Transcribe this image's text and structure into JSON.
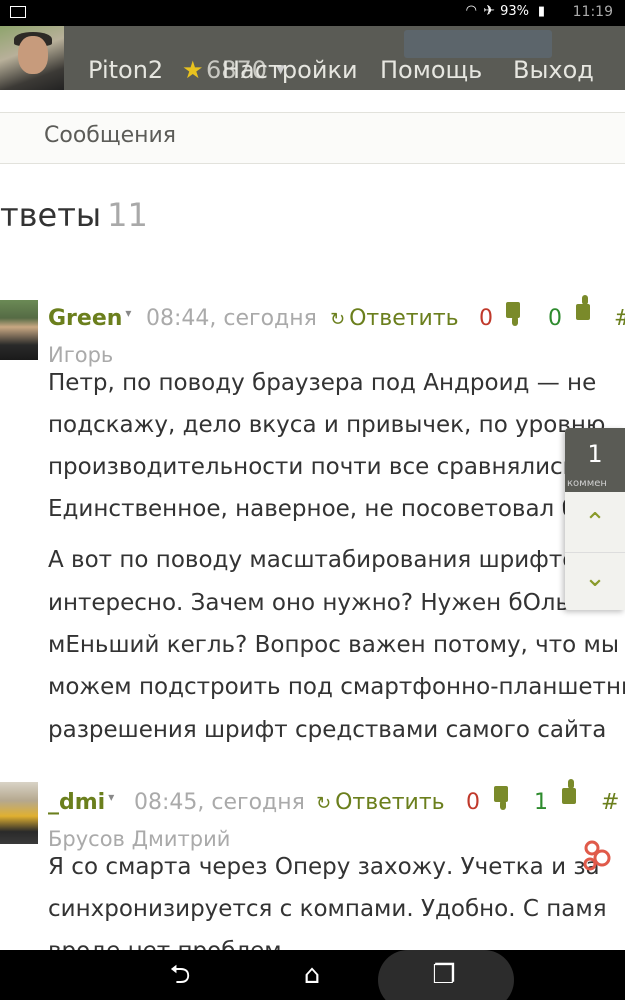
{
  "status_bar": {
    "battery_pct": "93%",
    "time": "11:19",
    "icons": [
      "image-icon",
      "wifi-icon",
      "airplane-icon",
      "battery-icon"
    ]
  },
  "header": {
    "username": "Piton2",
    "score": "6870",
    "menu": [
      "Настройки",
      "Помощь",
      "Выход"
    ],
    "star_color": "#e8c21f"
  },
  "subbar": {
    "tab": "Сообщения"
  },
  "page": {
    "title": "тветы",
    "count": "11"
  },
  "comments": [
    {
      "author": "Green",
      "time": "08:44, сегодня",
      "reply_label": "Ответить",
      "dislikes": "0",
      "likes": "0",
      "hash": "#",
      "realname": "Игорь",
      "paragraphs": [
        "Петр, по поводу браузера под Андроид — не",
        "подскажу, дело вкуса и привычек, по уровню",
        "производительности почти все сравнялись.",
        "Единственное, наверное, не посоветовал бы",
        "А вот по поводу масштабирования шрифтов",
        "интересно. Зачем оно нужно? Нужен бОльший",
        "мЕньший кегль? Вопрос важен потому, что мы",
        "можем подстроить под смартфонно-планшетные",
        "разрешения шрифт средствами самого сайта"
      ]
    },
    {
      "author": "_dmi",
      "time": "08:45, сегодня",
      "reply_label": "Ответить",
      "dislikes": "0",
      "likes": "1",
      "hash": "#",
      "realname": "Брусов Дмитрий",
      "paragraphs": [
        "Я со смарта через Оперу захожу. Учетка и за",
        "синхронизируется с компами. Удобно. С памя",
        "вроде нет проблем"
      ]
    }
  ],
  "float_panel": {
    "count": "1",
    "label": "коммен"
  },
  "colors": {
    "accent_green": "#6b7f1d",
    "header_bg": "#5a5b55",
    "negative": "#c0392b",
    "positive": "#2e8b2e"
  }
}
